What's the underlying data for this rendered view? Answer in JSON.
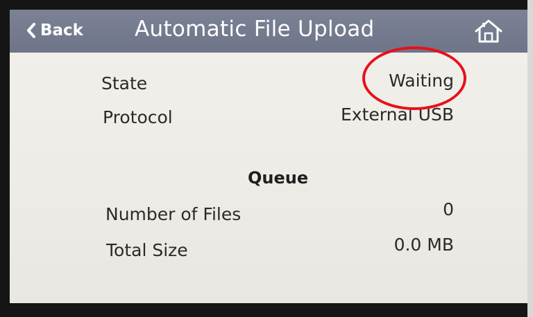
{
  "header": {
    "back_label": "Back",
    "title": "Automatic File Upload",
    "back_icon": "chevron-left-icon",
    "home_icon": "home-icon"
  },
  "status": {
    "state_label": "State",
    "state_value": "Waiting",
    "protocol_label": "Protocol",
    "protocol_value": "External USB"
  },
  "queue": {
    "title": "Queue",
    "files_label": "Number of Files",
    "files_value": "0",
    "size_label": "Total Size",
    "size_value": "0.0 MB"
  },
  "colors": {
    "header_bg": "#737a8d",
    "screen_bg": "#efede7",
    "annotation": "#e8101b"
  }
}
